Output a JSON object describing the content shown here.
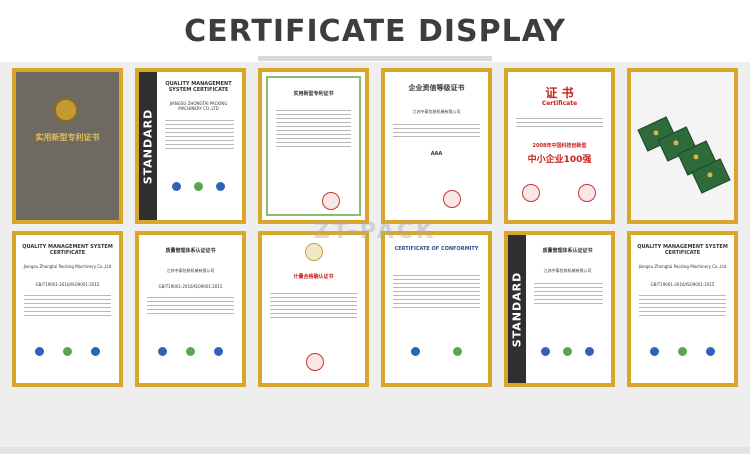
{
  "header": {
    "title": "CERTIFICATE DISPLAY"
  },
  "watermark": "ZT-PACK",
  "colors": {
    "frame_gold": "#d9a62a",
    "grid_bg": "#eeeeee",
    "title": "#3d3d3d"
  },
  "row1": [
    {
      "kind": "cover",
      "text": "实用新型专利证书"
    },
    {
      "kind": "iso",
      "heading": "QUALITY MANAGEMENT SYSTEM CERTIFICATE",
      "company": "JIANGSU ZHONGTAI PACKING MACHINERY CO.,LTD",
      "standard_band": "STANDARD"
    },
    {
      "kind": "patent",
      "heading": "实用新型专利证书"
    },
    {
      "kind": "credit",
      "heading": "企业资信等级证书",
      "company": "江苏中泰包装机械有限公司",
      "rating": "AAA"
    },
    {
      "kind": "red",
      "heading": "证 书",
      "sub": "Certificate",
      "line1": "2008年中国科技创新型",
      "line2": "中小企业100强"
    },
    {
      "kind": "books"
    }
  ],
  "row2": [
    {
      "kind": "iso",
      "heading": "QUALITY MANAGEMENT SYSTEM CERTIFICATE",
      "company": "Jiangsu Zhongtai Packing Machinery Co.,Ltd",
      "std": "GB/T19001-2016/ISO9001:2015"
    },
    {
      "kind": "cn",
      "heading": "质量管理体系认证证书",
      "company": "江苏中泰包装机械有限公司",
      "std": "GB/T19001-2016/ISO9001:2015"
    },
    {
      "kind": "cn2",
      "heading": "计量合格确认证书"
    },
    {
      "kind": "ce",
      "heading": "CERTIFICATE OF CONFORMITY"
    },
    {
      "kind": "cn3",
      "heading": "质量管理体系认证证书",
      "company": "江苏中泰包装机械有限公司",
      "standard_band": "STANDARD"
    },
    {
      "kind": "iso",
      "heading": "QUALITY MANAGEMENT SYSTEM CERTIFICATE",
      "company": "Jiangsu Zhongtai Packing Machinery Co.,Ltd",
      "std": "GB/T19001-2016/ISO9001:2015"
    }
  ]
}
